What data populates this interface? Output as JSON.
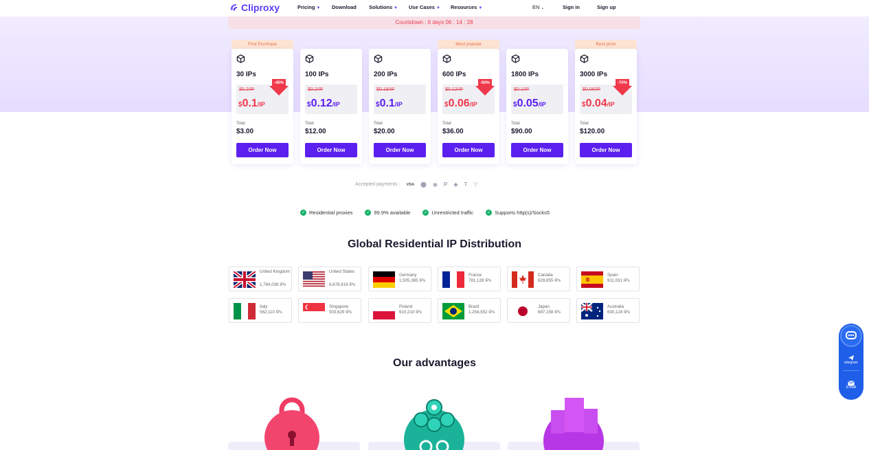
{
  "nav": {
    "logo": "Cliproxy",
    "items": [
      "Pricing",
      "Download",
      "Solutions",
      "Use Cases",
      "Resources"
    ],
    "lang": "EN",
    "signin": "Sign in",
    "signup": "Sign up"
  },
  "countdown": "Countdown : 6  days 06 : 14 : 28",
  "plans": [
    {
      "tag": "First Purchase",
      "ips": "30 IPs",
      "old": "$0.2/IP",
      "dollar": "$",
      "price": "0.1",
      "unit": "/IP",
      "discount": "-45%",
      "total": "$3.00",
      "price_color": "#f0384b"
    },
    {
      "tag": "",
      "ips": "100 IPs",
      "old": "$0.2/IP",
      "dollar": "$",
      "price": "0.12",
      "unit": "/IP",
      "discount": "",
      "total": "$12.00",
      "price_color": "#5b1ff0"
    },
    {
      "tag": "",
      "ips": "200 IPs",
      "old": "$0.18/IP",
      "dollar": "$",
      "price": "0.1",
      "unit": "/IP",
      "discount": "",
      "total": "$20.00",
      "price_color": "#5b1ff0"
    },
    {
      "tag": "Most popular",
      "ips": "600 IPs",
      "old": "$0.12/IP",
      "dollar": "$",
      "price": "0.06",
      "unit": "/IP",
      "discount": "-50%",
      "total": "$36.00",
      "price_color": "#f0384b"
    },
    {
      "tag": "",
      "ips": "1800 IPs",
      "old": "$0.1/IP",
      "dollar": "$",
      "price": "0.05",
      "unit": "/IP",
      "discount": "",
      "total": "$90.00",
      "price_color": "#5b1ff0"
    },
    {
      "tag": "Best price",
      "ips": "3000 IPs",
      "old": "$0.06/IP",
      "dollar": "$",
      "price": "0.04",
      "unit": "/IP",
      "discount": "-70%",
      "total": "$120.00",
      "price_color": "#f0384b"
    }
  ],
  "total_label": "Total",
  "order_label": "Order Now",
  "payments_label": "Accepted payments :",
  "payment_icons": [
    "visa-icon",
    "mastercard-icon",
    "coin-icon",
    "paypal-icon",
    "ethereum-icon",
    "tether-icon",
    "tron-icon"
  ],
  "features": [
    "Residential proxies",
    "99.9% available",
    "Unrestricted traffic",
    "Supports http(s)/Socks5"
  ],
  "distribution_title": "Global Residential IP Distribution",
  "countries": [
    {
      "name": "United Kingdom",
      "ips": "1,784,036 IPs",
      "flag": "uk"
    },
    {
      "name": "United States",
      "ips": "8,678,619 IPs",
      "flag": "us"
    },
    {
      "name": "Germany",
      "ips": "1,505,365 IPs",
      "flag": "de"
    },
    {
      "name": "France",
      "ips": "781,128 IPs",
      "flag": "fr"
    },
    {
      "name": "Canada",
      "ips": "629,855 IPs",
      "flag": "ca"
    },
    {
      "name": "Spain",
      "ips": "911,031 IPs",
      "flag": "es"
    },
    {
      "name": "Italy",
      "ips": "562,110 IPs",
      "flag": "it"
    },
    {
      "name": "Singapore",
      "ips": "503,629 IPs",
      "flag": "sg"
    },
    {
      "name": "Poland",
      "ips": "610,210 IPs",
      "flag": "pl"
    },
    {
      "name": "Brazil",
      "ips": "1,254,552 IPs",
      "flag": "br"
    },
    {
      "name": "Japan",
      "ips": "687,158 IPs",
      "flag": "jp"
    },
    {
      "name": "Australia",
      "ips": "630,124 IPs",
      "flag": "au"
    }
  ],
  "advantages_title": "Our advantages",
  "float": {
    "telegram": "telegram",
    "email": "E-mail"
  },
  "colors": {
    "brand": "#5b1ff0",
    "accent": "#f0384b",
    "float": "#1f5ee8"
  }
}
